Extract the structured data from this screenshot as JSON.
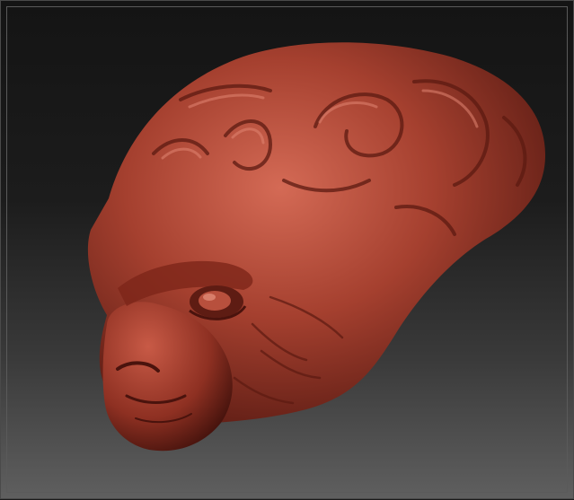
{
  "viewport": {
    "background_top": "#141414",
    "background_bottom": "#5f5f5f",
    "frame_color": "#5a5a5a"
  },
  "model": {
    "subject": "sculpted-alien-head",
    "material_base": "#a5402f",
    "material_highlight": "#d46a55",
    "material_shadow": "#4a130d"
  }
}
